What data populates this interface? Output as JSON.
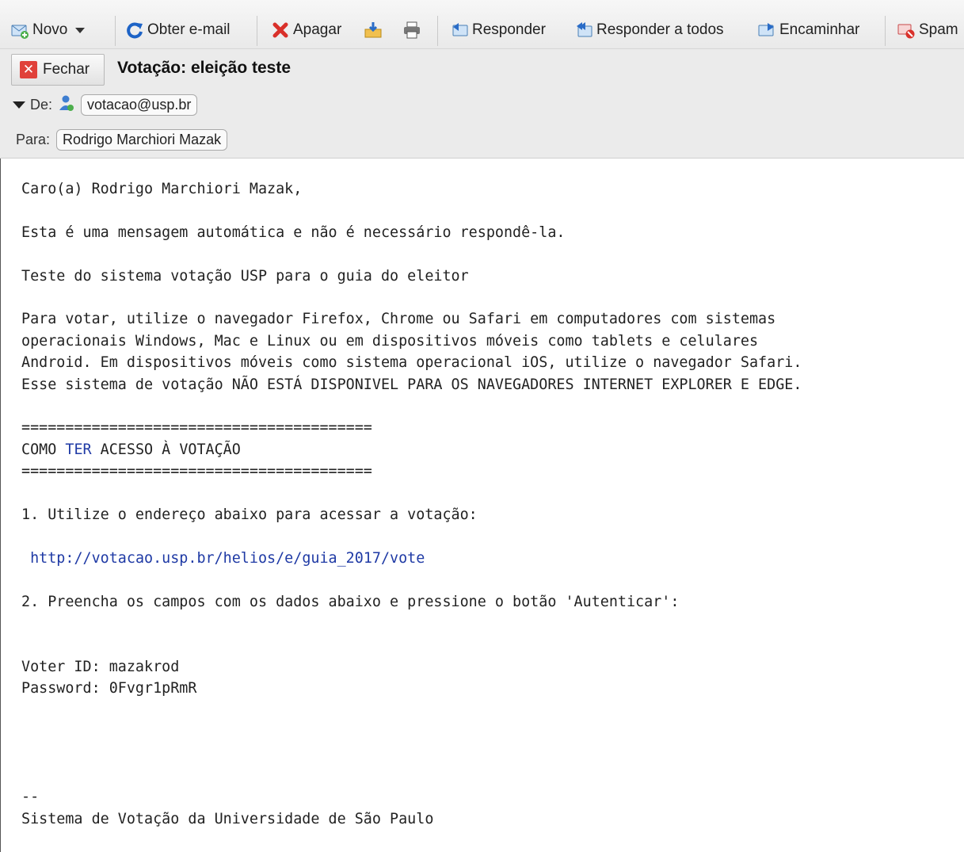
{
  "toolbar": {
    "new_label": "Novo",
    "get_mail_label": "Obter e-mail",
    "delete_label": "Apagar",
    "reply_label": "Responder",
    "reply_all_label": "Responder a todos",
    "forward_label": "Encaminhar",
    "spam_label": "Spam"
  },
  "header": {
    "close_label": "Fechar",
    "subject": "Votação: eleição teste",
    "from_label": "De:",
    "from_address": "votacao@usp.br",
    "to_label": "Para:",
    "to_name": "Rodrigo Marchiori Mazak"
  },
  "body": {
    "greeting": "Caro(a) Rodrigo Marchiori Mazak,",
    "auto_notice": "Esta é uma mensagem automática e não é necessário respondê-la.",
    "test_line": "Teste do sistema votação USP para o guia do eleitor",
    "browser_p1": "Para votar, utilize o navegador Firefox, Chrome ou Safari em computadores com sistemas",
    "browser_p2": "operacionais Windows, Mac e Linux ou em dispositivos móveis como tablets e celulares",
    "browser_p3": "Android. Em dispositivos móveis como sistema operacional iOS, utilize o navegador Safari.",
    "browser_p4": "Esse sistema de votação NÃO ESTÁ DISPONIVEL PARA OS NAVEGADORES INTERNET EXPLORER E EDGE.",
    "separator": "========================================",
    "section_pre": "COMO ",
    "section_highlight": "TER",
    "section_post": " ACESSO À VOTAÇÃO",
    "step1": "1. Utilize o endereço abaixo para acessar a votação:",
    "vote_url": "http://votacao.usp.br/helios/e/guia_2017/vote",
    "step2": "2. Preencha os campos com os dados abaixo e pressione o botão 'Autenticar':",
    "voter_id_line": "Voter ID: mazakrod",
    "password_line": "Password: 0Fvgr1pRmR",
    "sig_dash": "--",
    "signature": "Sistema de Votação da Universidade de São Paulo"
  },
  "colors": {
    "link": "#1f3aa5",
    "close_red": "#e0413a",
    "header_bg": "#ebebeb"
  },
  "icons": [
    "new-mail-icon",
    "dropdown-arrow-icon",
    "refresh-icon",
    "delete-x-icon",
    "archive-icon",
    "print-icon",
    "reply-icon",
    "reply-all-icon",
    "forward-icon",
    "spam-icon",
    "close-icon",
    "expand-triangle-icon",
    "contact-icon"
  ]
}
